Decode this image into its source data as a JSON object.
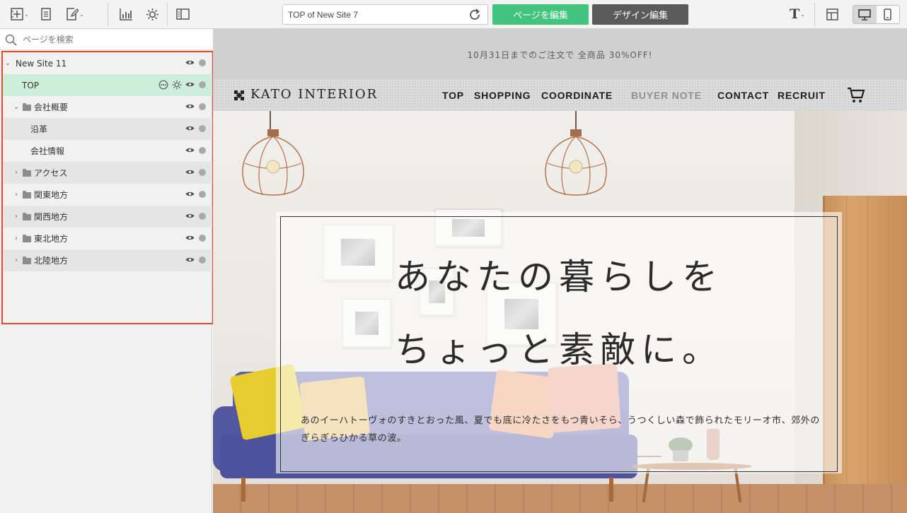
{
  "toolbar": {
    "url": "TOP of New Site 7",
    "edit_page_label": "ページを編集",
    "edit_design_label": "デザイン編集",
    "text_tool_label": "T"
  },
  "sidebar": {
    "search_placeholder": "ページを検索",
    "tree": [
      {
        "label": "New Site 11",
        "type": "site",
        "expanded": true
      },
      {
        "label": "TOP",
        "type": "page",
        "selected": true
      },
      {
        "label": "会社概要",
        "type": "folder",
        "expanded": true
      },
      {
        "label": "沿革",
        "type": "page"
      },
      {
        "label": "会社情報",
        "type": "page"
      },
      {
        "label": "アクセス",
        "type": "folder",
        "expanded": false
      },
      {
        "label": "関東地方",
        "type": "folder",
        "expanded": false
      },
      {
        "label": "関西地方",
        "type": "folder",
        "expanded": false
      },
      {
        "label": "東北地方",
        "type": "folder",
        "expanded": false
      },
      {
        "label": "北陸地方",
        "type": "folder",
        "expanded": false
      }
    ]
  },
  "site": {
    "announcement": "10月31日までのご注文で 全商品 30%OFF!",
    "logo": "KATO INTERIOR",
    "nav": [
      "TOP",
      "SHOPPING",
      "COORDINATE",
      "BUYER NOTE",
      "CONTACT",
      "RECRUIT"
    ],
    "hero_line1": "あなたの暮らしを",
    "hero_line2": "ちょっと素敵に。",
    "hero_body": "あのイーハトーヴォのすきとおった風、夏でも底に冷たさをもつ青いそら、うつくしい森で飾られたモリーオ市、郊外のぎらぎらひかる草の波。"
  },
  "colors": {
    "accent_green": "#43c47e",
    "design_button": "#5a5a5a",
    "selected_row": "#cdefd9",
    "highlight_border": "#e04a2f"
  },
  "icons": [
    "add-block-icon",
    "page-icon",
    "edit-page-icon",
    "analytics-icon",
    "settings-icon",
    "sidebar-toggle-icon",
    "reload-icon",
    "text-tool-icon",
    "layout-icon",
    "desktop-icon",
    "mobile-icon",
    "search-icon",
    "eye-icon",
    "options-icon",
    "cart-icon"
  ]
}
